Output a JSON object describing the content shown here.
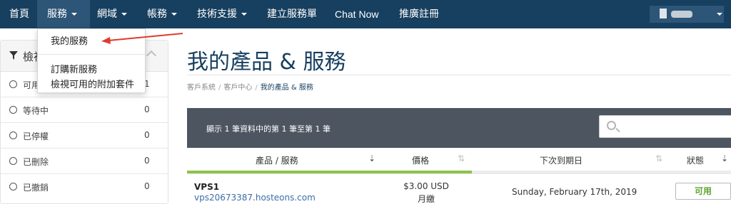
{
  "nav": {
    "home": "首頁",
    "services": "服務",
    "domains": "網域",
    "account": "帳務",
    "support": "技術支援",
    "open_ticket": "建立服務單",
    "chat": "Chat Now",
    "affiliates": "推廣註冊",
    "bg_color": "#173f5f",
    "active_color": "#2c5577"
  },
  "dropdown": {
    "my_services": "我的服務",
    "order_new": "訂購新服務",
    "addons": "檢視可用的附加套件"
  },
  "sidebar": {
    "title": "檢視",
    "filters": [
      {
        "label": "可用",
        "count": "1"
      },
      {
        "label": "等待中",
        "count": "0"
      },
      {
        "label": "已停權",
        "count": "0"
      },
      {
        "label": "已刪除",
        "count": "0"
      },
      {
        "label": "已撤銷",
        "count": "0"
      }
    ]
  },
  "main": {
    "title": "我的產品 & 服務",
    "breadcrumb": [
      "客戶系統",
      "客戶中心",
      "我的產品 & 服務"
    ],
    "showing": "顯示 1 筆資料中的第 1 筆至第 1 筆",
    "search_placeholder": ""
  },
  "table": {
    "headers": [
      "產品 / 服務",
      "價格",
      "下次到期日",
      "狀態"
    ],
    "rows": [
      {
        "product": "VPS1",
        "domain": "vps20673387.hosteons.com",
        "price": "$3.00 USD",
        "cycle": "月繳",
        "due": "Sunday, February 17th, 2019",
        "status": "可用"
      }
    ],
    "accent_color": "#8bc34a",
    "header_bg": "#4d5560"
  }
}
